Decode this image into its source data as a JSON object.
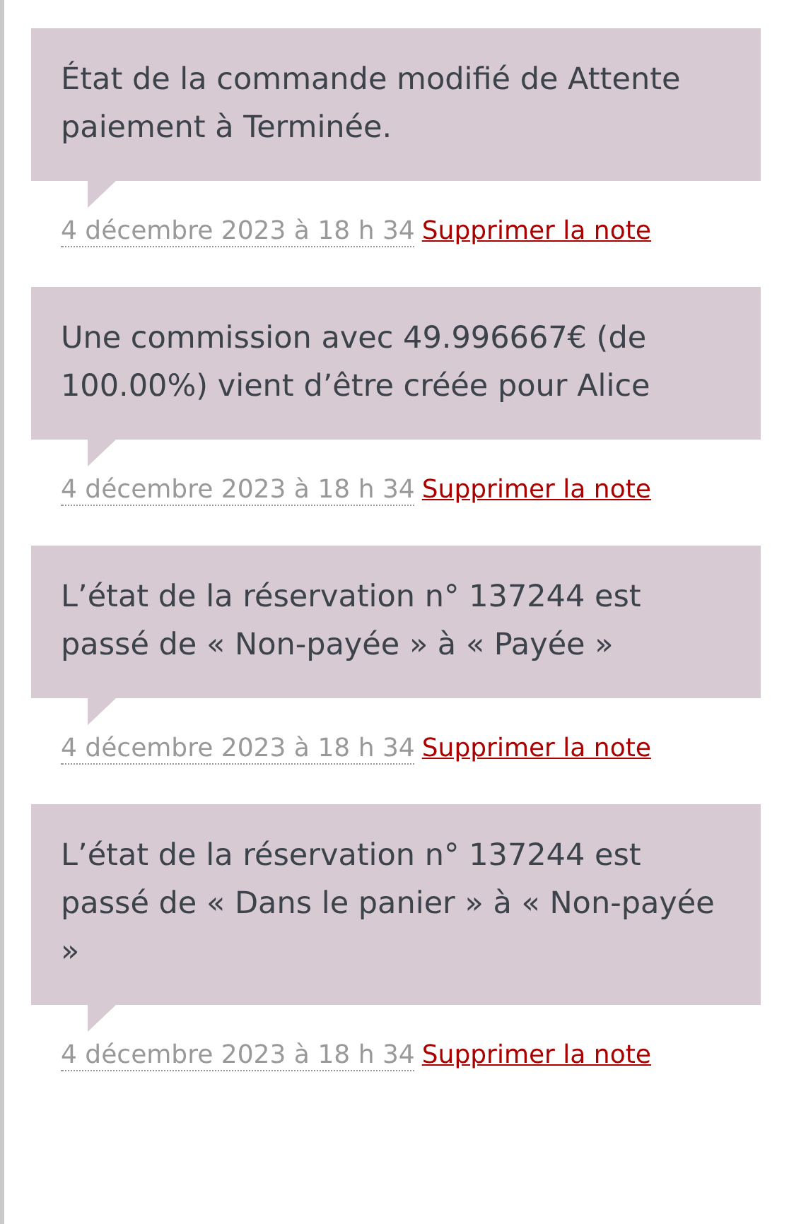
{
  "notes": [
    {
      "content": "État de la commande modifié de Attente paiement à Terminée.",
      "date": "4 décembre 2023 à 18 h 34",
      "delete_link": "Supprimer la note"
    },
    {
      "content": "Une commission avec 49.996667€ (de 100.00%) vient d’être créée pour Alice",
      "date": "4 décembre 2023 à 18 h 34",
      "delete_link": "Supprimer la note"
    },
    {
      "content": "L’état de la réservation n° 137244 est passé de « Non-payée » à « Payée »",
      "date": "4 décembre 2023 à 18 h 34",
      "delete_link": "Supprimer la note"
    },
    {
      "content": "L’état de la réservation n° 137244 est passé de « Dans le panier » à « Non-payée »",
      "date": "4 décembre 2023 à 18 h 34",
      "delete_link": "Supprimer la note"
    }
  ]
}
